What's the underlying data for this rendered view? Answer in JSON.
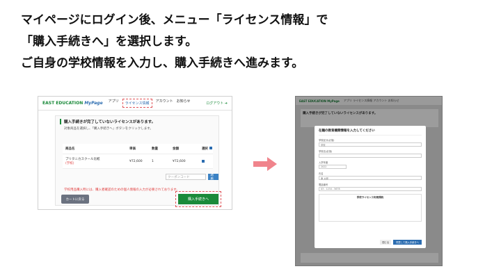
{
  "instructions": [
    "マイページにログイン後、メニュー「ライセンス情報」で",
    "「購入手続きへ」を選択します。",
    "ご自身の学校情報を入力し、購入手続きへ進みます。"
  ],
  "shot1": {
    "brand_main": "EAST EDUCATION",
    "brand_sub": "MyPage",
    "nav": [
      "アプリ",
      "ライセンス情報",
      "アカウント",
      "お知らせ"
    ],
    "logout": "ログアウト",
    "panel_title": "購入手続きが完了していないライセンスがあります。",
    "panel_sub": "対象商品を選択し、「購入手続きへ」ボタンをクリックします。",
    "table_headers": [
      "商品名",
      "単価",
      "数量",
      "金額",
      "選択"
    ],
    "row": {
      "name": "ブリタニカスクール比較",
      "badge": "(学校)",
      "price": "¥72,600",
      "qty": "1",
      "amount": "¥72,600"
    },
    "coupon_placeholder": "クーポンコード",
    "coupon_button": "適用",
    "warning": "学校用品購入時には、購入者確認のための個人情報の入力が必要されております。",
    "back_button": "カートに戻る",
    "buy_button": "購入手続きへ"
  },
  "shot2": {
    "brand": "EAST EDUCATION MyPage",
    "nav": "アプリ ライセンス情報 アカウント お知らせ",
    "bg_title": "購入手続きが完了していないライセンスがあります。",
    "modal_title": "在籍の教育機関情報を入力してください",
    "fields": [
      {
        "label": "学校区分(必須)",
        "value": "学校"
      },
      {
        "label": "学校名(必須)",
        "value": ""
      },
      {
        "label": "入学年度",
        "value": "2022"
      },
      {
        "label": "氏名",
        "value": "東 太郎"
      },
      {
        "label": "電話番号",
        "value": "03 - 1234 - 5678"
      }
    ],
    "terms_title": "学校ライセンス利用規約",
    "cancel": "閉じる",
    "submit": "同意して購入手続きへ"
  },
  "colors": {
    "accent_green": "#1a8a3a",
    "highlight": "#e0555a",
    "arrow": "#f0848c"
  }
}
